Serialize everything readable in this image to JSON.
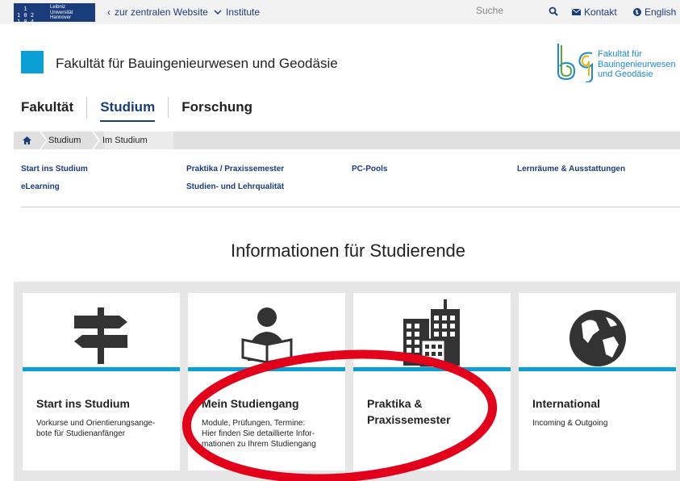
{
  "topbar": {
    "logo_glyph": "  1  \n1 0 2\n1 0 4",
    "logo_text": "Leibniz\nUniversität\nHannover",
    "central_link": "zur zentralen Website",
    "institutes_link": "Institute",
    "search_placeholder": "Suche",
    "contact": "Kontakt",
    "language": "English"
  },
  "header": {
    "faculty_title": "Fakultät für Bauingenieurwesen und Geodäsie",
    "logo_text": "Fakultät für\nBauingenieurwesen\nund Geodäsie"
  },
  "mainnav": {
    "items": [
      "Fakultät",
      "Studium",
      "Forschung"
    ]
  },
  "breadcrumb": {
    "items": [
      "Studium",
      "Im Studium"
    ]
  },
  "sublinks": [
    "Start ins Studium",
    "eLearning",
    "Praktika / Praxissemester",
    "Studien- und Lehrqualität",
    "PC-Pools",
    "Lernräume & Ausstattungen"
  ],
  "section": {
    "title": "Informationen für Studierende"
  },
  "cards": [
    {
      "title": "Start ins Studium",
      "desc": "Vorkurse und Orientierungsange-\nbote für Studienanfänger",
      "icon": "signpost-icon"
    },
    {
      "title": "Mein Studiengang",
      "desc": "Module, Prüfungen, Termine:\nHier finden Sie detaillierte Infor-\nmationen zu Ihrem Studiengang",
      "icon": "reader-icon"
    },
    {
      "title": "Praktika &\nPraxissemester",
      "desc": "",
      "icon": "buildings-icon"
    },
    {
      "title": "International",
      "desc": "Incoming & Outgoing",
      "icon": "globe-icon"
    }
  ],
  "colors": {
    "accent": "#0aa0d6",
    "navy": "#1a3c7a",
    "annotation": "#e3001b"
  }
}
